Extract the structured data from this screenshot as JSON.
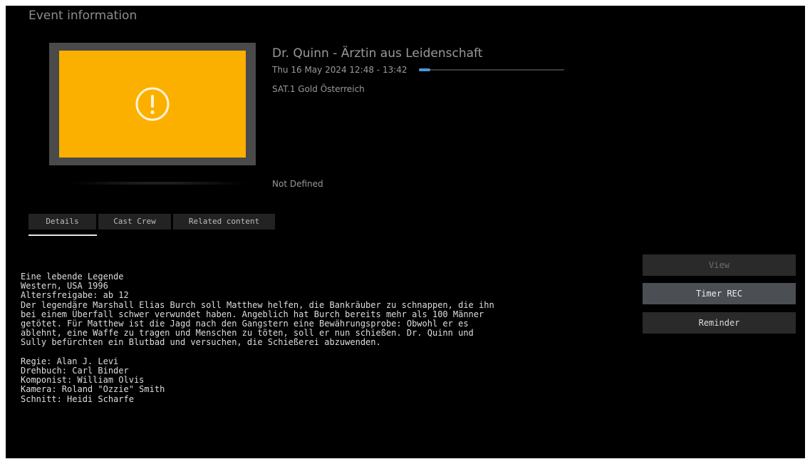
{
  "page": {
    "title": "Event information"
  },
  "event": {
    "thumbnail_icon": "warning-icon",
    "thumbnail_color": "#fbb000",
    "title": "Dr. Quinn - Ärztin aus Leidenschaft",
    "time": "Thu 16 May 2024 12:48 - 13:42",
    "progress_percent": 8,
    "channel": "SAT.1 Gold Österreich",
    "genre": "Not Defined"
  },
  "tabs": [
    {
      "label": "Details",
      "selected": true
    },
    {
      "label": "Cast Crew",
      "selected": false
    },
    {
      "label": "Related content",
      "selected": false
    }
  ],
  "details": {
    "text": "Eine lebende Legende\nWestern, USA 1996\nAltersfreigabe: ab 12\nDer legendäre Marshall Elias Burch soll Matthew helfen, die Bankräuber zu schnappen, die ihn\nbei einem Überfall schwer verwundet haben. Angeblich hat Burch bereits mehr als 100 Männer\ngetötet. Für Matthew ist die Jagd nach den Gangstern eine Bewährungsprobe: Obwohl er es\nablehnt, eine Waffe zu tragen und Menschen zu töten, soll er nun schießen. Dr. Quinn und\nSully befürchten ein Blutbad und versuchen, die Schießerei abzuwenden.\n\nRegie: Alan J. Levi\nDrehbuch: Carl Binder\nKomponist: William Olvis\nKamera: Roland \"Ozzie\" Smith\nSchnitt: Heidi Scharfe"
  },
  "actions": {
    "view_label": "View",
    "timer_rec_label": "Timer REC",
    "reminder_label": "Reminder",
    "focused": "Timer REC"
  },
  "colors": {
    "background": "#000000",
    "accent_progress": "#4f96d8",
    "focused_button": "#4b4f54"
  }
}
